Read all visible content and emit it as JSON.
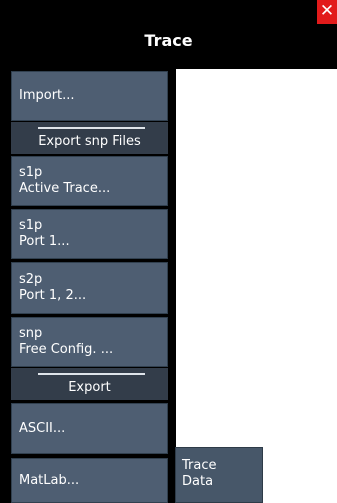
{
  "window": {
    "title": "Trace",
    "close_label": "✕"
  },
  "menu": {
    "import_label": "Import...",
    "export_snp_section": "Export snp Files",
    "s1p_active": {
      "line1": "s1p",
      "line2": "Active Trace..."
    },
    "s1p_port": {
      "line1": "s1p",
      "line2": "Port 1..."
    },
    "s2p_port": {
      "line1": "s2p",
      "line2": "Port 1, 2..."
    },
    "snp_free": {
      "line1": "snp",
      "line2": "Free Config. ..."
    },
    "export_section": "Export",
    "ascii_label": "ASCII...",
    "matlab_label": "MatLab..."
  },
  "submenu": {
    "line1": "Trace",
    "line2": "Data"
  },
  "colors": {
    "title_bar": "#000000",
    "close_button": "#e21b1b",
    "button_bg": "#4e5e72",
    "section_bg": "#333d4a"
  }
}
